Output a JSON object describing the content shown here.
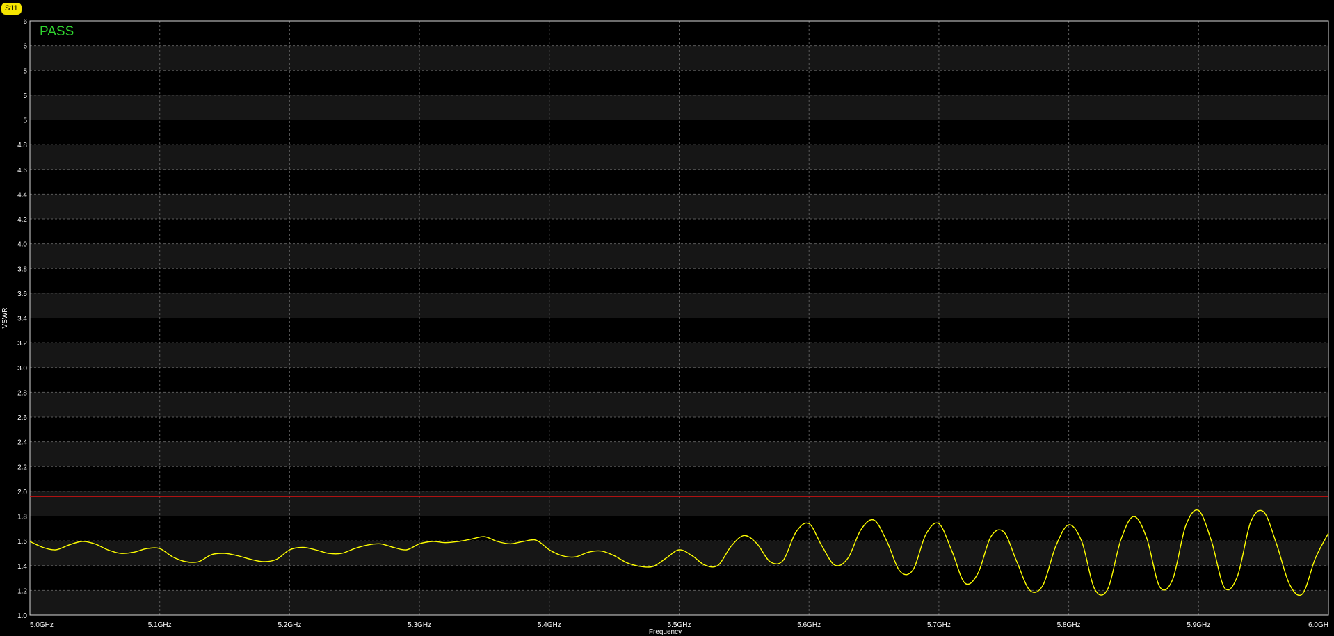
{
  "trace_badge": "S11",
  "status_text": "PASS",
  "colors": {
    "background": "#000000",
    "band": "#161616",
    "grid": "#5a5a5a",
    "trace": "#ffff00",
    "limit": "#e01010",
    "status": "#2fd52f",
    "badge": "#f5e500"
  },
  "chart_data": {
    "type": "line",
    "xlabel": "Frequency",
    "ylabel": "VSWR",
    "xlim": [
      5.0,
      6.0
    ],
    "ylim": [
      1.0,
      6.0
    ],
    "x_ticks": [
      5.0,
      5.1,
      5.2,
      5.3,
      5.4,
      5.5,
      5.6,
      5.7,
      5.8,
      5.9,
      6.0
    ],
    "x_tick_labels": [
      "5.0GHz",
      "5.1GHz",
      "5.2GHz",
      "5.3GHz",
      "5.4GHz",
      "5.5GHz",
      "5.6GHz",
      "5.7GHz",
      "5.8GHz",
      "5.9GHz",
      "6.0GH"
    ],
    "y_tick_labels": [
      "1.0",
      "1.2",
      "1.4",
      "1.6",
      "1.8",
      "2.0",
      "2.2",
      "2.4",
      "2.6",
      "2.8",
      "3.0",
      "3.2",
      "3.4",
      "3.6",
      "3.8",
      "4.0",
      "4.2",
      "4.4",
      "4.6",
      "4.8",
      "5",
      "5",
      "5",
      "6",
      "6"
    ],
    "grid": true,
    "limit_line": {
      "value": 2.0
    },
    "series": [
      {
        "x": [
          5.0,
          5.01,
          5.02,
          5.03,
          5.04,
          5.05,
          5.06,
          5.07,
          5.08,
          5.09,
          5.1,
          5.11,
          5.12,
          5.13,
          5.14,
          5.15,
          5.16,
          5.17,
          5.18,
          5.19,
          5.2,
          5.21,
          5.22,
          5.23,
          5.24,
          5.25,
          5.26,
          5.27,
          5.28,
          5.29,
          5.3,
          5.31,
          5.32,
          5.33,
          5.34,
          5.35,
          5.36,
          5.37,
          5.38,
          5.39,
          5.4,
          5.41,
          5.42,
          5.43,
          5.44,
          5.45,
          5.46,
          5.47,
          5.48,
          5.49,
          5.5,
          5.51,
          5.52,
          5.53,
          5.54,
          5.55,
          5.56,
          5.57,
          5.58,
          5.59,
          5.6,
          5.61,
          5.62,
          5.63,
          5.64,
          5.65,
          5.66,
          5.67,
          5.68,
          5.69,
          5.7,
          5.71,
          5.72,
          5.73,
          5.74,
          5.75,
          5.76,
          5.77,
          5.78,
          5.79,
          5.8,
          5.81,
          5.82,
          5.83,
          5.84,
          5.85,
          5.86,
          5.87,
          5.88,
          5.89,
          5.9,
          5.91,
          5.92,
          5.93,
          5.94,
          5.95,
          5.96,
          5.97,
          5.98,
          5.99,
          6.0
        ],
        "y": [
          1.62,
          1.57,
          1.55,
          1.59,
          1.62,
          1.6,
          1.55,
          1.52,
          1.53,
          1.56,
          1.56,
          1.49,
          1.45,
          1.45,
          1.51,
          1.52,
          1.5,
          1.47,
          1.45,
          1.47,
          1.55,
          1.57,
          1.55,
          1.52,
          1.52,
          1.56,
          1.59,
          1.6,
          1.57,
          1.55,
          1.6,
          1.62,
          1.61,
          1.62,
          1.64,
          1.66,
          1.62,
          1.6,
          1.62,
          1.63,
          1.55,
          1.5,
          1.49,
          1.53,
          1.54,
          1.5,
          1.44,
          1.41,
          1.41,
          1.48,
          1.55,
          1.5,
          1.42,
          1.42,
          1.58,
          1.67,
          1.6,
          1.45,
          1.46,
          1.7,
          1.77,
          1.58,
          1.42,
          1.48,
          1.72,
          1.8,
          1.62,
          1.37,
          1.38,
          1.68,
          1.77,
          1.54,
          1.27,
          1.35,
          1.66,
          1.7,
          1.45,
          1.21,
          1.25,
          1.58,
          1.76,
          1.62,
          1.22,
          1.22,
          1.63,
          1.83,
          1.65,
          1.24,
          1.3,
          1.75,
          1.88,
          1.62,
          1.23,
          1.33,
          1.78,
          1.87,
          1.6,
          1.26,
          1.18,
          1.48,
          1.69
        ]
      }
    ]
  }
}
